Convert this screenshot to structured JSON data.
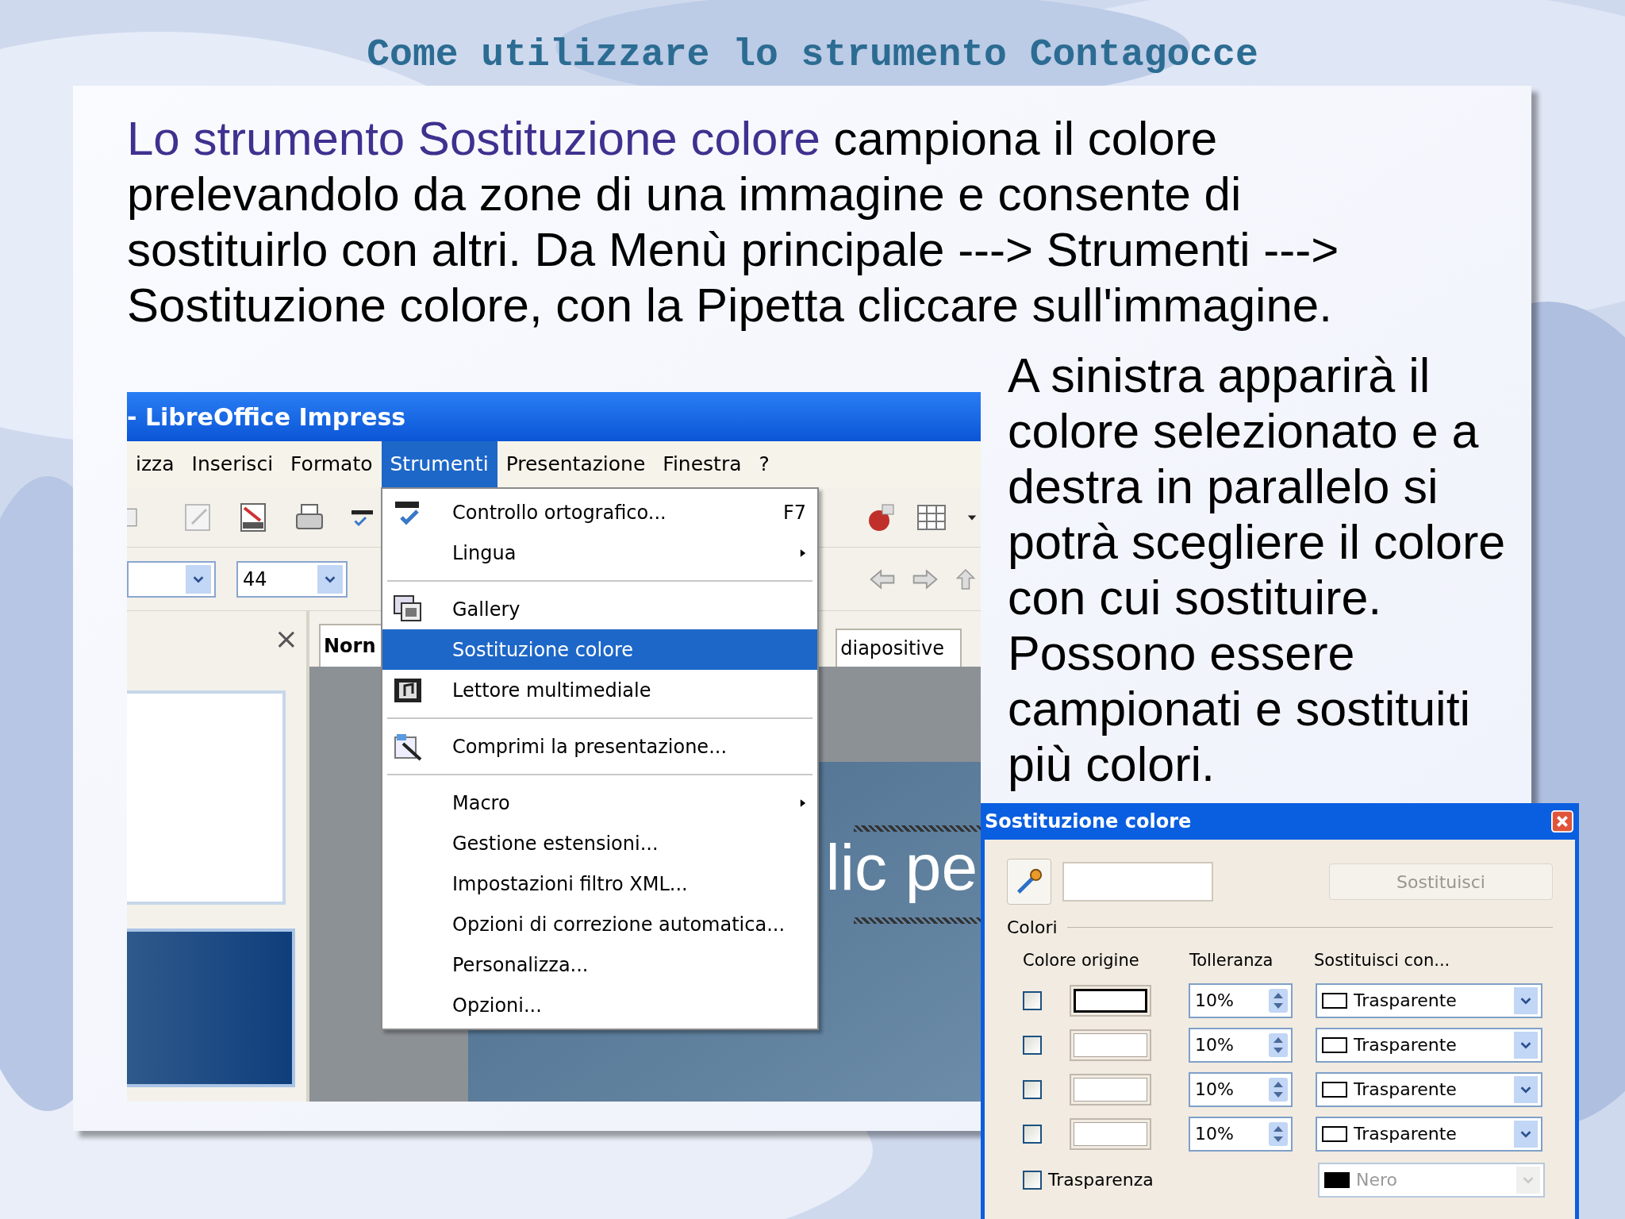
{
  "slide_title": "Come utilizzare lo strumento Contagocce",
  "intro": {
    "highlight": "Lo strumento Sostituzione colore",
    "text": " campiona il colore prelevandolo da zone di una immagine e consente di sostituirlo con altri. Da Menù principale ---> Strumenti ---> Sostituzione colore, con la Pipetta cliccare sull'immagine."
  },
  "side_text": "A sinistra apparirà il colore selezionato e a destra in parallelo si potrà scegliere il colore con cui sostituire. Possono essere campionati e sostituiti più colori.",
  "screenshot": {
    "window_title": "- LibreOffice Impress",
    "menus": [
      {
        "label": "izza",
        "selected": false
      },
      {
        "label": "Inserisci",
        "selected": false
      },
      {
        "label": "Formato",
        "selected": false
      },
      {
        "label": "Strumenti",
        "selected": true
      },
      {
        "label": "Presentazione",
        "selected": false
      },
      {
        "label": "Finestra",
        "selected": false
      },
      {
        "label": "?",
        "selected": false
      }
    ],
    "font_size": "44",
    "close_glyph": "×",
    "tabs": [
      "Norn",
      "diapositive"
    ],
    "slide_text": "lic pe",
    "menu_items": [
      {
        "kind": "item",
        "label": "Controllo ortografico...",
        "shortcut": "F7",
        "submenu": false,
        "selected": false
      },
      {
        "kind": "item",
        "label": "Lingua",
        "submenu": true,
        "selected": false
      },
      {
        "kind": "separator"
      },
      {
        "kind": "item",
        "label": "Gallery",
        "submenu": false,
        "selected": false
      },
      {
        "kind": "item",
        "label": "Sostituzione colore",
        "submenu": false,
        "selected": true
      },
      {
        "kind": "item",
        "label": "Lettore multimediale",
        "submenu": false,
        "selected": false
      },
      {
        "kind": "separator"
      },
      {
        "kind": "item",
        "label": "Comprimi la presentazione...",
        "submenu": false,
        "selected": false
      },
      {
        "kind": "separator"
      },
      {
        "kind": "item",
        "label": "Macro",
        "submenu": true,
        "selected": false
      },
      {
        "kind": "item",
        "label": "Gestione estensioni...",
        "submenu": false,
        "selected": false
      },
      {
        "kind": "item",
        "label": "Impostazioni filtro XML...",
        "submenu": false,
        "selected": false
      },
      {
        "kind": "item",
        "label": "Opzioni di correzione automatica...",
        "submenu": false,
        "selected": false
      },
      {
        "kind": "item",
        "label": "Personalizza...",
        "submenu": false,
        "selected": false
      },
      {
        "kind": "item",
        "label": "Opzioni...",
        "submenu": false,
        "selected": false
      }
    ]
  },
  "dialog": {
    "title": "Sostituzione colore",
    "replace_button": {
      "label": "Sostituisci",
      "disabled": true
    },
    "group_label": "Colori",
    "columns": [
      "Colore origine",
      "Tolleranza",
      "Sostituisci con..."
    ],
    "rows": [
      {
        "checked": false,
        "selected": true,
        "tolerance": "10%",
        "replacement": "Trasparente"
      },
      {
        "checked": false,
        "selected": false,
        "tolerance": "10%",
        "replacement": "Trasparente"
      },
      {
        "checked": false,
        "selected": false,
        "tolerance": "10%",
        "replacement": "Trasparente"
      },
      {
        "checked": false,
        "selected": false,
        "tolerance": "10%",
        "replacement": "Trasparente"
      }
    ],
    "transparency": {
      "label": "Trasparenza",
      "checked": false,
      "replacement": "Nero",
      "color": "#000000",
      "disabled": true
    }
  }
}
